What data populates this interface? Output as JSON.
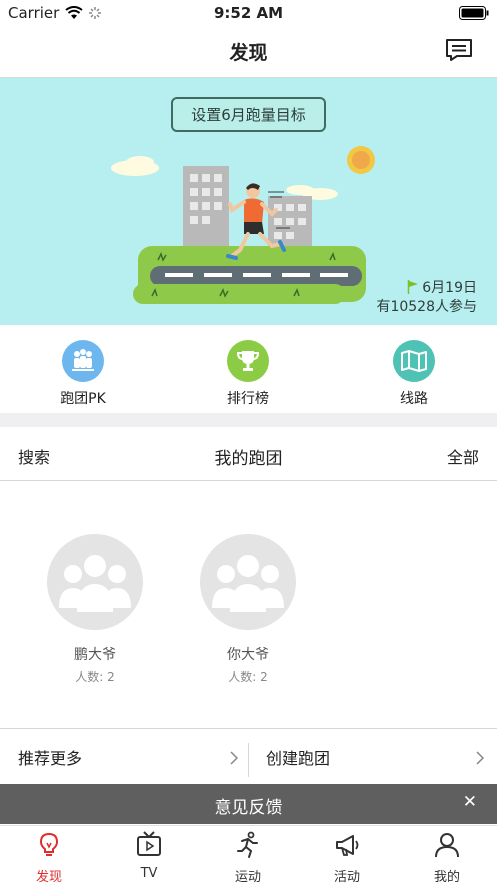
{
  "status_bar": {
    "carrier": "Carrier",
    "time": "9:52 AM"
  },
  "nav": {
    "title": "发现",
    "message_icon": "message-icon"
  },
  "banner": {
    "goal_button": "设置6月跑量目标",
    "date": "6月19日",
    "participants": "有10528人参与"
  },
  "shortcuts": [
    {
      "label": "跑团PK",
      "icon": "team-pk-icon",
      "color": "#6db6ee"
    },
    {
      "label": "排行榜",
      "icon": "trophy-icon",
      "color": "#8ccc45"
    },
    {
      "label": "线路",
      "icon": "map-icon",
      "color": "#4fc2b6"
    }
  ],
  "team_header": {
    "search": "搜索",
    "title": "我的跑团",
    "all": "全部"
  },
  "teams": [
    {
      "name": "鹏大爷",
      "count": "人数: 2"
    },
    {
      "name": "你大爷",
      "count": "人数: 2"
    }
  ],
  "actions": {
    "recommend": "推荐更多",
    "create": "创建跑团"
  },
  "feedback": {
    "title": "意见反馈",
    "close": "✕"
  },
  "tabs": [
    {
      "label": "发现",
      "icon": "bulb-icon",
      "active": true
    },
    {
      "label": "TV",
      "icon": "tv-icon",
      "active": false
    },
    {
      "label": "运动",
      "icon": "run-icon",
      "active": false
    },
    {
      "label": "活动",
      "icon": "megaphone-icon",
      "active": false
    },
    {
      "label": "我的",
      "icon": "person-icon",
      "active": false
    }
  ],
  "colors": {
    "accent": "#e02d2d",
    "banner_bg": "#b7eff0",
    "feedback_bg": "#5f5f5f"
  }
}
